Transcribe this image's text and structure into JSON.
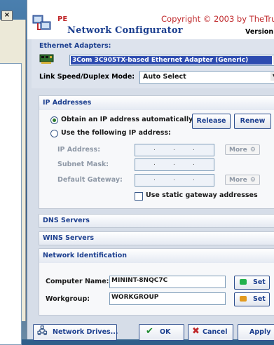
{
  "background_window": {
    "close_label": "×"
  },
  "header": {
    "pe_label": "PE",
    "title": "Network Configurator",
    "copyright": "Copyright © 2003 by TheTru",
    "version": "Version"
  },
  "adapters": {
    "label": "Ethernet Adapters:",
    "selected": "3Com 3C905TX-based Ethernet Adapter (Generic)",
    "link_label": "Link Speed/Duplex Mode:",
    "link_value": "Auto Select"
  },
  "ip_addresses": {
    "title": "IP Addresses",
    "option_auto": "Obtain an IP address automatically",
    "option_manual": "Use the following IP address:",
    "selected_option": "auto",
    "release_label": "Release",
    "renew_label": "Renew",
    "ip_label": "IP Address:",
    "subnet_label": "Subnet Mask:",
    "gateway_label": "Default Gateway:",
    "more_label": "More",
    "static_gateway_label": "Use static gateway addresses"
  },
  "panels": {
    "dns": "DNS Servers",
    "wins": "WINS Servers",
    "netid": "Network Identification"
  },
  "network_identification": {
    "computer_label": "Computer Name:",
    "computer_value": "MININT-8NQC7C",
    "workgroup_label": "Workgroup:",
    "workgroup_value": "WORKGROUP",
    "set_label": "Set",
    "computer_set_color": "#22b14c",
    "workgroup_set_color": "#e39a1e"
  },
  "footer": {
    "network_drives_label": "Network Drives...",
    "ok_label": "OK",
    "cancel_label": "Cancel",
    "apply_label": "Apply"
  },
  "colors": {
    "accent": "#1c3f8f",
    "brand_red": "#c0282b",
    "selection": "#2d4bb0"
  }
}
